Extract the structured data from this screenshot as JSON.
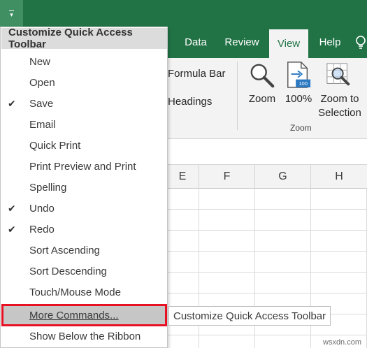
{
  "tabs": {
    "data": "Data",
    "review": "Review",
    "view": "View",
    "help": "Help"
  },
  "ribbon": {
    "formula_bar": "Formula Bar",
    "headings": "Headings",
    "zoom": "Zoom",
    "hundred_percent": "100%",
    "zoom_to": "Zoom to",
    "selection": "Selection",
    "group_zoom": "Zoom",
    "hundred_icon_text": "100"
  },
  "columns": [
    "E",
    "F",
    "G",
    "H"
  ],
  "menu": {
    "header": "Customize Quick Access Toolbar",
    "items": [
      {
        "label": "New",
        "checked": false
      },
      {
        "label": "Open",
        "checked": false
      },
      {
        "label": "Save",
        "checked": true
      },
      {
        "label": "Email",
        "checked": false
      },
      {
        "label": "Quick Print",
        "checked": false
      },
      {
        "label": "Print Preview and Print",
        "checked": false
      },
      {
        "label": "Spelling",
        "checked": false
      },
      {
        "label": "Undo",
        "checked": true
      },
      {
        "label": "Redo",
        "checked": true
      },
      {
        "label": "Sort Ascending",
        "checked": false
      },
      {
        "label": "Sort Descending",
        "checked": false
      },
      {
        "label": "Touch/Mouse Mode",
        "checked": false
      },
      {
        "label": "More Commands...",
        "checked": false
      },
      {
        "label": "Show Below the Ribbon",
        "checked": false
      }
    ],
    "check_glyph": "✔"
  },
  "tooltip": "Customize Quick Access Toolbar",
  "watermark": "wsxdn.com",
  "colors": {
    "excel_green": "#217346",
    "highlight_outline": "#e81123",
    "menu_header_bg": "#dcdcdc",
    "ribbon_bg": "#f3f3f3"
  },
  "icons": {
    "qat_dropdown": "chevron-down-icon",
    "zoom": "magnifier-icon",
    "hundred_percent": "page-100-icon",
    "zoom_to_selection": "zoom-selection-icon",
    "help": "lightbulb-icon",
    "check": "check-icon"
  }
}
